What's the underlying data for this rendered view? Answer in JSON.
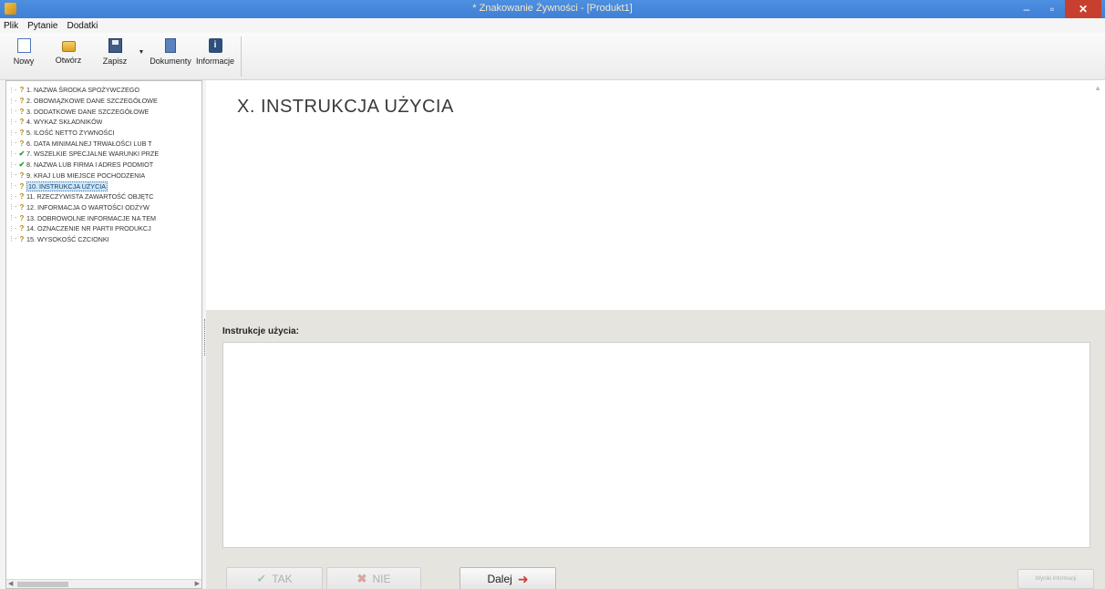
{
  "window": {
    "title": "* Znakowanie Żywności - [Produkt1]",
    "controls": {
      "minimize": "–",
      "maximize": "▫",
      "close": "✕"
    }
  },
  "menu": [
    "Plik",
    "Pytanie",
    "Dodatki"
  ],
  "toolbar": {
    "new": "Nowy",
    "open": "Otwórz",
    "save": "Zapisz",
    "dropdown": "▼",
    "documents": "Dokumenty",
    "info": "Informacje",
    "info_glyph": "i"
  },
  "tree": {
    "items": [
      {
        "label": "1. NAZWA ŚRODKA SPOŻYWCZEGO",
        "status": "?"
      },
      {
        "label": "2. OBOWIĄZKOWE DANE SZCZEGÓŁOWE",
        "status": "?"
      },
      {
        "label": "3. DODATKOWE DANE SZCZEGÓŁOWE",
        "status": "?"
      },
      {
        "label": "4. WYKAZ SKŁADNIKÓW",
        "status": "?"
      },
      {
        "label": "5. ILOŚĆ NETTO ŻYWNOŚCI",
        "status": "?"
      },
      {
        "label": "6. DATA MINIMALNEJ TRWAŁOŚCI LUB T",
        "status": "?"
      },
      {
        "label": "7. WSZELKIE SPECJALNE WARUNKI PRZE",
        "status": "✔"
      },
      {
        "label": "8. NAZWA LUB FIRMA I ADRES PODMIOT",
        "status": "✔"
      },
      {
        "label": "9. KRAJ LUB MIEJSCE POCHODZENIA",
        "status": "?"
      },
      {
        "label": "10. INSTRUKCJA UŻYCIA",
        "status": "?",
        "selected": true
      },
      {
        "label": "11. RZECZYWISTA ZAWARTOŚĆ OBJĘTC",
        "status": "?"
      },
      {
        "label": "12. INFORMACJA O WARTOŚCI ODŻYW",
        "status": "?"
      },
      {
        "label": "13. DOBROWOLNE INFORMACJE NA TEM",
        "status": "?"
      },
      {
        "label": "14. OZNACZENIE NR PARTII PRODUKCJ",
        "status": "?"
      },
      {
        "label": "15. WYSOKOŚĆ CZCIONKI",
        "status": "?"
      }
    ]
  },
  "main": {
    "section_title": "X. INSTRUKCJA UŻYCIA",
    "field_label": "Instrukcje użycia:",
    "field_value": ""
  },
  "buttons": {
    "yes": "TAK",
    "no": "NIE",
    "next": "Dalej",
    "small_button": "Wyniki informacji"
  },
  "colors": {
    "titlebar": "#4289dc",
    "close": "#c7402f",
    "selected_item": "#cde6f7",
    "next_arrow": "#d23a3a"
  }
}
